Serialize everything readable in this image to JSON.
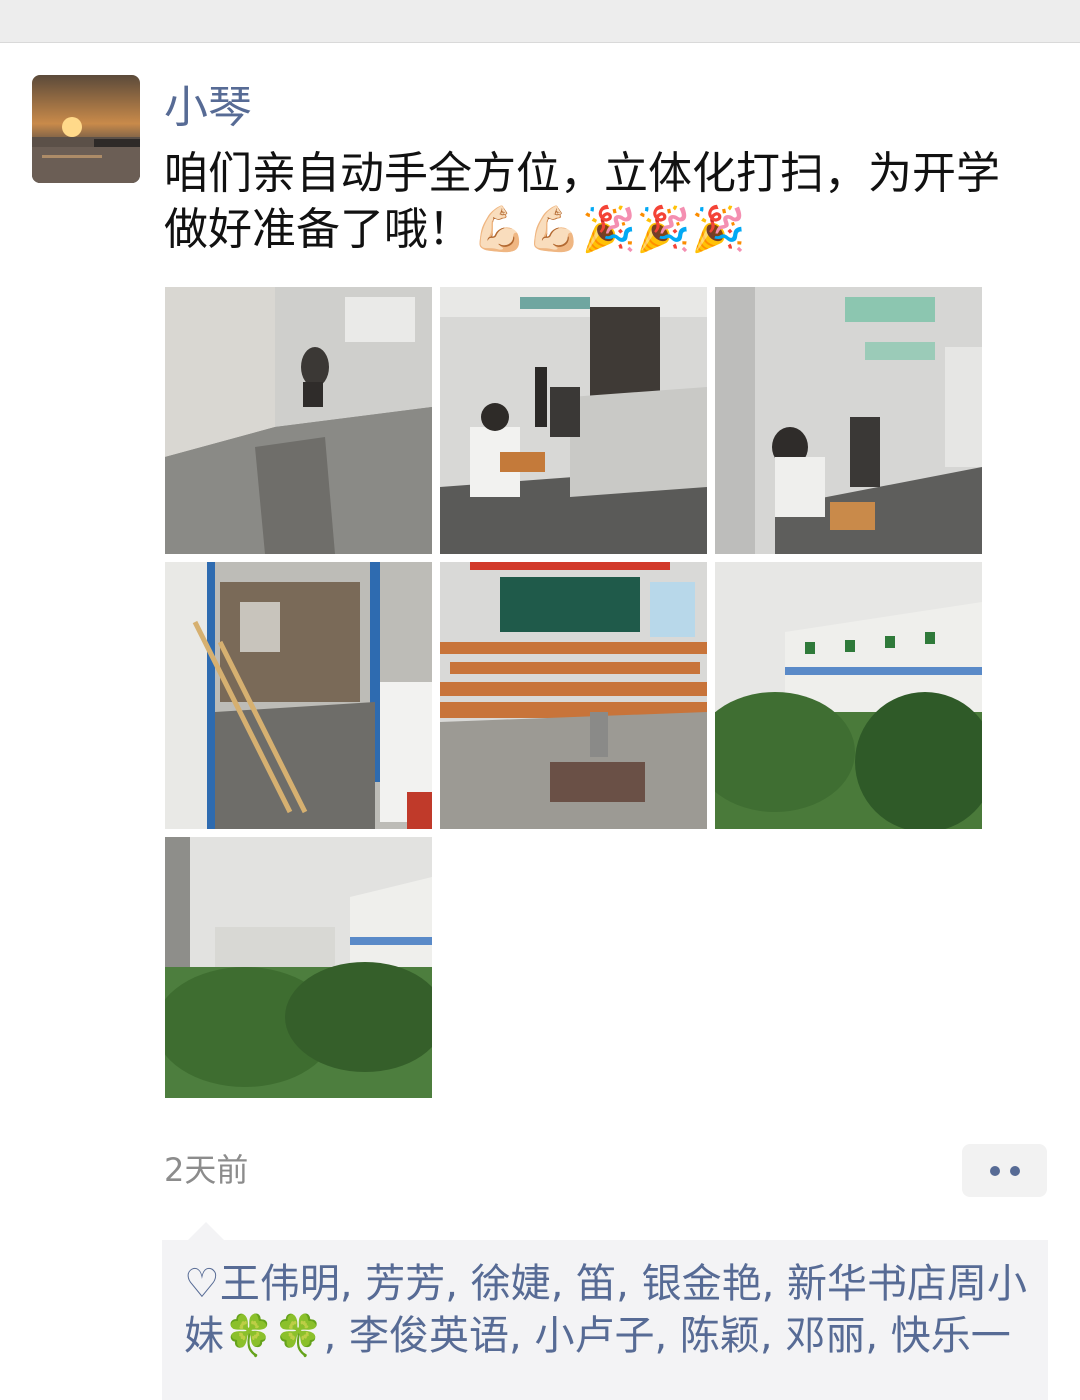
{
  "post": {
    "username": "小琴",
    "text": "咱们亲自动手全方位，立体化打扫，为开学做好准备了哦！💪🏻💪🏻🎉🎉🎉",
    "time": "2天前",
    "photos": [
      {
        "name": "photo-hallway-mopping",
        "scene": "hallway"
      },
      {
        "name": "photo-corridor-sweeping",
        "scene": "corridor"
      },
      {
        "name": "photo-corridor-cleaning",
        "scene": "corridor2"
      },
      {
        "name": "photo-classroom-brooms",
        "scene": "brooms"
      },
      {
        "name": "photo-classroom-desks",
        "scene": "classroom"
      },
      {
        "name": "photo-school-building",
        "scene": "building"
      },
      {
        "name": "photo-trees-view",
        "scene": "trees"
      }
    ]
  },
  "likes": {
    "icon": "heart-icon",
    "names_text": "王伟明, 芳芳, 徐婕, 笛, 银金艳, 新华书店周小妹🍀🍀, 李俊英语, 小卢子, 陈颖, 邓丽, 快乐一"
  },
  "colors": {
    "link": "#576b95",
    "text": "#111111",
    "meta": "#8c8c8c",
    "likes_bg": "#f3f3f5"
  }
}
